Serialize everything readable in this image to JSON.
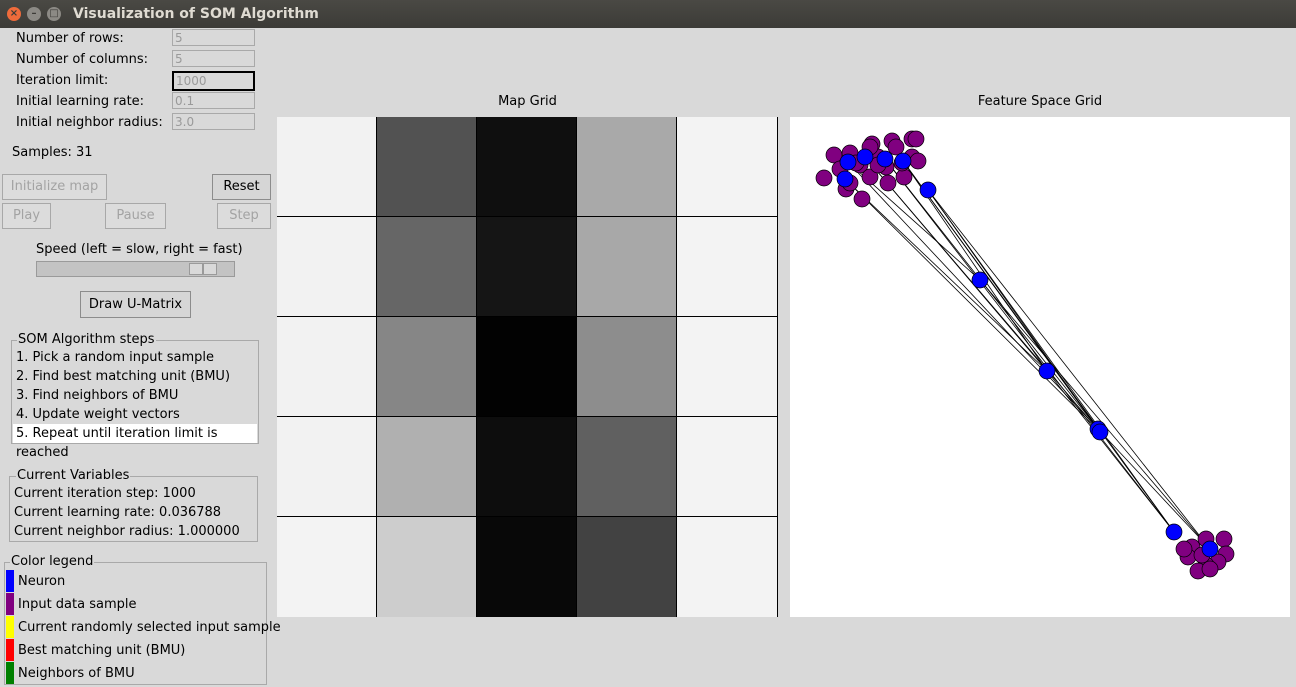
{
  "window": {
    "title": "Visualization of SOM Algorithm"
  },
  "params": {
    "rows": {
      "label": "Number of rows:",
      "value": "5"
    },
    "cols": {
      "label": "Number of columns:",
      "value": "5"
    },
    "iter": {
      "label": "Iteration limit:",
      "value": "1000"
    },
    "lr": {
      "label": "Initial learning rate:",
      "value": "0.1"
    },
    "radius": {
      "label": "Initial neighbor radius:",
      "value": "3.0"
    }
  },
  "samples_text": "Samples: 31",
  "buttons": {
    "init": "Initialize map",
    "reset": "Reset",
    "play": "Play",
    "pause": "Pause",
    "step": "Step",
    "umatrix": "Draw U-Matrix"
  },
  "speed": {
    "label": "Speed (left = slow, right = fast)",
    "level": 0.9
  },
  "steps": {
    "title": "SOM Algorithm steps",
    "items": [
      "1. Pick a random input sample",
      "2. Find best matching unit (BMU)",
      "3. Find neighbors of BMU",
      "4. Update weight vectors",
      "5. Repeat until iteration limit is reached"
    ]
  },
  "current": {
    "title": "Current Variables",
    "iteration": "Current iteration step: 1000",
    "learning_rate": "Current learning rate: 0.036788",
    "radius": "Current neighbor radius: 1.000000"
  },
  "legend": {
    "title": "Color legend",
    "items": [
      {
        "label": "Neuron",
        "color": "#0000ff"
      },
      {
        "label": "Input data sample",
        "color": "#800080"
      },
      {
        "label": "Current randomly selected input sample",
        "color": "#ffff00"
      },
      {
        "label": "Best matching unit (BMU)",
        "color": "#ff0000"
      },
      {
        "label": "Neighbors of BMU",
        "color": "#008000"
      }
    ]
  },
  "map_grid": {
    "title": "Map Grid",
    "colors": [
      [
        "#f2f2f2",
        "#525252",
        "#0f0f0f",
        "#a9a9a9",
        "#f3f3f3"
      ],
      [
        "#f2f2f2",
        "#666666",
        "#151515",
        "#a8a8a8",
        "#f3f3f3"
      ],
      [
        "#f2f2f2",
        "#868686",
        "#020202",
        "#8d8d8d",
        "#f3f3f3"
      ],
      [
        "#f2f2f2",
        "#b0b0b0",
        "#0d0d0d",
        "#606060",
        "#f3f3f3"
      ],
      [
        "#f3f3f3",
        "#cdcdcd",
        "#080808",
        "#424242",
        "#f3f3f3"
      ]
    ]
  },
  "feature_grid": {
    "title": "Feature Space Grid"
  }
}
